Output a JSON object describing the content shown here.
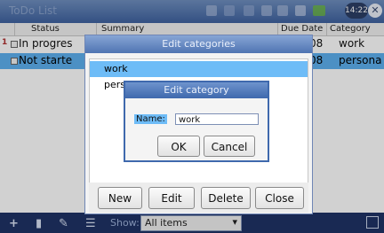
{
  "app": {
    "name": "ToDo List",
    "clock": "14:22"
  },
  "table": {
    "headers": [
      "Status",
      "Summary",
      "Due Date",
      "Category"
    ],
    "rows": [
      {
        "num": "1",
        "status": "In progres",
        "due": "/08",
        "category": "work",
        "selected": false
      },
      {
        "num": "",
        "status": "Not starte",
        "due": "/08",
        "category": "persona",
        "selected": true
      }
    ]
  },
  "bottombar": {
    "show_label": "Show:",
    "filter_value": "All items"
  },
  "categories_dialog": {
    "title": "Edit categories",
    "items": [
      "work",
      "pers"
    ],
    "buttons": {
      "new": "New",
      "edit": "Edit",
      "delete": "Delete",
      "close": "Close"
    }
  },
  "category_dialog": {
    "title": "Edit category",
    "name_label": "Name:",
    "name_value": "work",
    "buttons": {
      "ok": "OK",
      "cancel": "Cancel"
    }
  },
  "colors": {
    "selection": "#5db0f0",
    "titlebar": "#4f74b2",
    "bottombar": "#1f3366"
  }
}
